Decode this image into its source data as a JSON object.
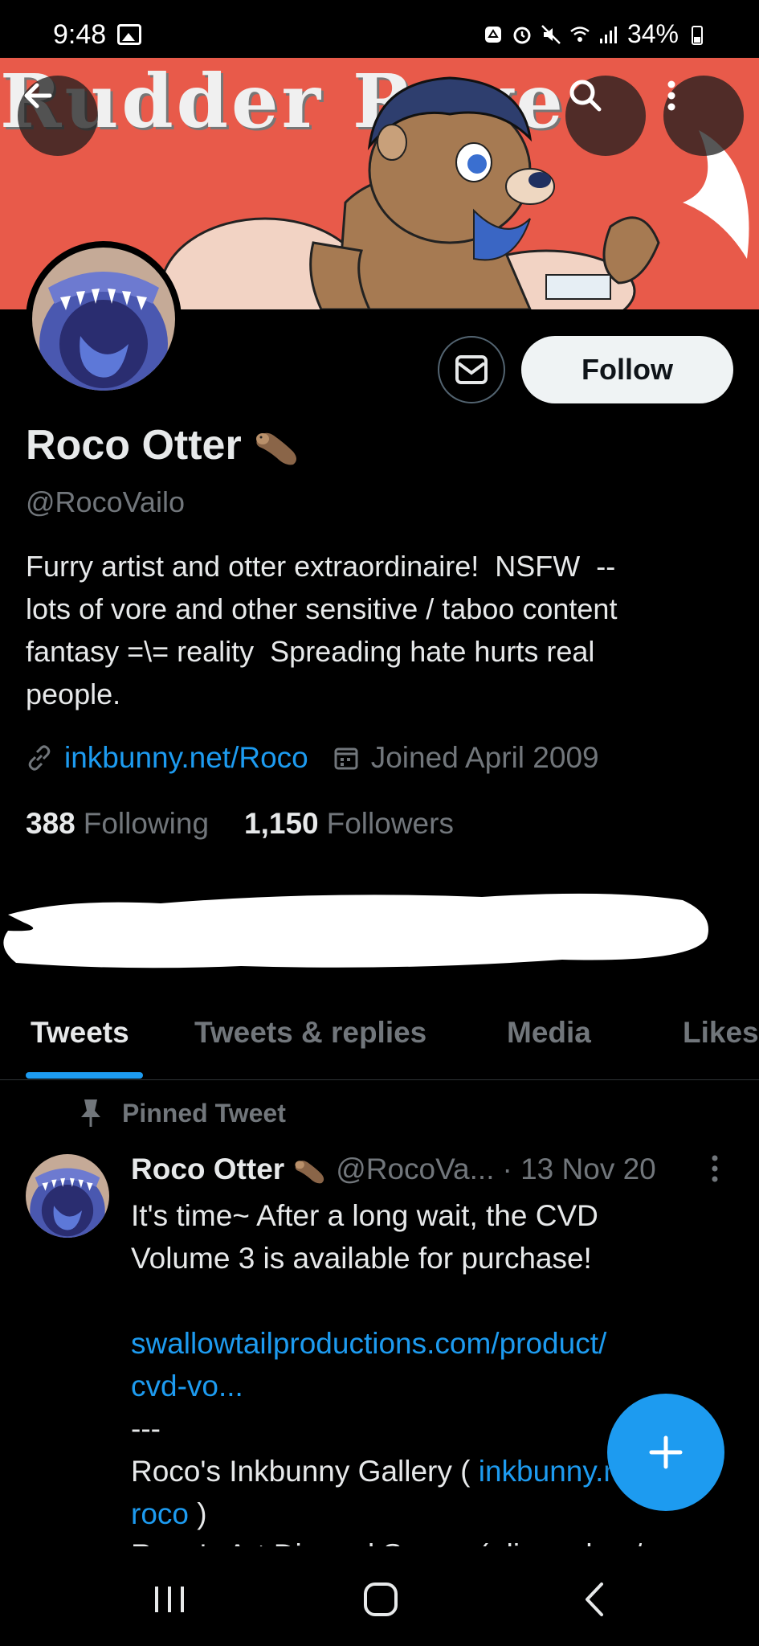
{
  "status_bar": {
    "time": "9:48",
    "battery": "34%"
  },
  "banner": {
    "text": "Rudder Rove"
  },
  "profile": {
    "display_name": "Roco Otter",
    "handle": "@RocoVailo",
    "bio": "Furry artist and otter extraordinaire!  NSFW  --\nlots of vore and other sensitive / taboo content\nfantasy =\\= reality  Spreading hate hurts real\npeople.",
    "link": "inkbunny.net/Roco",
    "joined": "Joined April 2009",
    "following_count": "388",
    "following_label": "Following",
    "followers_count": "1,150",
    "followers_label": "Followers",
    "follow_button": "Follow"
  },
  "tabs": [
    {
      "label": "Tweets"
    },
    {
      "label": "Tweets & replies"
    },
    {
      "label": "Media"
    },
    {
      "label": "Likes"
    }
  ],
  "tweet": {
    "pinned_label": "Pinned Tweet",
    "author": "Roco Otter",
    "handle": "@RocoVa...",
    "date": "· 13 Nov 20",
    "line1": "It's time~ After a long wait, the CVD",
    "line2": "Volume 3 is available for purchase!",
    "link1": "swallowtailproductions.com/product/",
    "link2": "cvd-vo...",
    "separator": "---",
    "gallery_text": "Roco's Inkbunny Gallery ( ",
    "gallery_link": "inkbunny.net/",
    "gallery_link2": "roco",
    "gallery_close": " )",
    "next_line": "Roco's Art Discord Server ( discord.gg/"
  },
  "colors": {
    "accent": "#1d9bf0",
    "background": "#000000",
    "banner": "#e85a4a",
    "muted_text": "#71767b"
  },
  "icons": [
    "back-arrow-icon",
    "search-icon",
    "more-vert-icon",
    "mail-icon",
    "link-icon",
    "calendar-icon",
    "pin-icon",
    "plus-icon",
    "otter-emoji-icon",
    "recents-icon",
    "home-icon",
    "nav-back-icon"
  ]
}
